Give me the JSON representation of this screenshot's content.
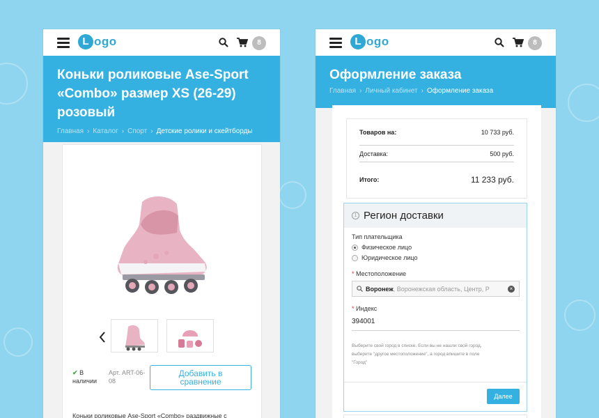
{
  "left": {
    "logo_letter": "L",
    "logo_text": "ogo",
    "cart_count": "8",
    "title_lines": [
      "Коньки роликовые Ase-Sport",
      "«Combo» размер XS (26-29)",
      "розовый"
    ],
    "breadcrumb": [
      "Главная",
      "Каталог",
      "Спорт",
      "Детские ролики и скейтборды"
    ],
    "stock_lines": [
      "В",
      "наличии"
    ],
    "article_lines": [
      "Арт. ART-06-",
      "08"
    ],
    "compare_lines": [
      "Добавить в",
      "сравнение"
    ],
    "description": "Коньки роликовые Ase-Sport «Combo» раздвижные с"
  },
  "right": {
    "logo_letter": "L",
    "logo_text": "ogo",
    "cart_count": "8",
    "title": "Оформление заказа",
    "breadcrumb": [
      "Главная",
      "Личный кабинет",
      "Оформление заказа"
    ],
    "summary": {
      "goods_label": "Товаров на:",
      "goods_value": "10 733 руб.",
      "delivery_label": "Доставка:",
      "delivery_value": "500 руб.",
      "total_label": "Итого:",
      "total_value": "11 233 руб."
    },
    "region": {
      "step": "1",
      "title": "Регион доставки",
      "payer_label": "Тип плательщика",
      "payer_options": [
        "Физическое лицо",
        "Юридическое лицо"
      ],
      "location_label": "Местоположение",
      "location_value": "Воронеж",
      "location_rest": ", Воронежская область, Центр, Р",
      "index_label": "Индекс",
      "index_value": "394001",
      "hint_lines": [
        "Выберите свой город в списке. Если вы не нашли свой город,",
        "выберите \"другое местоположение\", а город впишите в поле",
        "\"Город\""
      ],
      "next_label": "Далее"
    }
  },
  "colors": {
    "background": "#8fd5ef",
    "accent": "#35b1e1",
    "logo": "#2fa8d6"
  }
}
